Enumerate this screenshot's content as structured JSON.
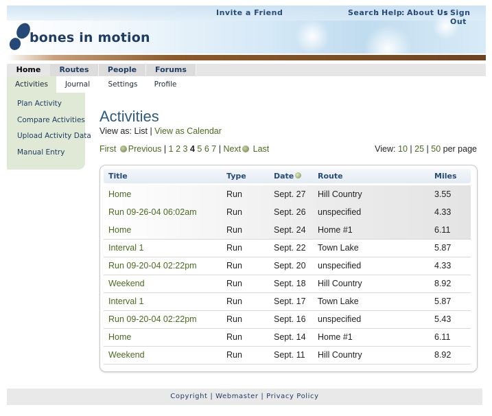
{
  "header": {
    "logo_text": "bones in motion",
    "invite_link": "Invite a Friend",
    "top_links": [
      "Search",
      "Help",
      "About Us",
      "Sign Out"
    ],
    "separator": ":"
  },
  "main_nav": {
    "tabs": [
      {
        "label": "Home",
        "active": true
      },
      {
        "label": "Routes",
        "active": false
      },
      {
        "label": "People",
        "active": false
      },
      {
        "label": "Forums",
        "active": false
      }
    ]
  },
  "sub_nav": {
    "tabs": [
      {
        "label": "Activities",
        "active": true
      },
      {
        "label": "Journal",
        "active": false
      },
      {
        "label": "Settings",
        "active": false
      },
      {
        "label": "Profile",
        "active": false
      }
    ]
  },
  "sidebar": {
    "items": [
      "Plan Activity",
      "Compare Activities",
      "Upload Activity Data",
      "Manual Entry"
    ]
  },
  "content": {
    "title": "Activities",
    "view_as_label": "View as:",
    "view_list": "List",
    "view_sep": "|",
    "view_calendar": "View as Calendar",
    "pager": {
      "first": "First",
      "previous": "Previous",
      "pages": [
        "1",
        "2",
        "3",
        "4",
        "5",
        "6",
        "7"
      ],
      "current_page": "4",
      "next": "Next",
      "last": "Last"
    },
    "per_page": {
      "label": "View:",
      "options": [
        "10",
        "25",
        "50"
      ],
      "suffix": "per page"
    },
    "table": {
      "headers": {
        "title": "Title",
        "type": "Type",
        "date": "Date",
        "route": "Route",
        "miles": "Miles"
      },
      "rows": [
        {
          "title": "Home",
          "type": "Run",
          "date": "Sept. 27",
          "route": "Hill Country",
          "miles": "3.55",
          "shaded": true
        },
        {
          "title": "Run 09-26-04 06:02am",
          "type": "Run",
          "date": "Sept. 26",
          "route": "unspecified",
          "miles": "4.33",
          "shaded": true
        },
        {
          "title": "Home",
          "type": "Run",
          "date": "Sept. 24",
          "route": "Home #1",
          "miles": "6.11",
          "shaded": true
        },
        {
          "title": "Interval 1",
          "type": "Run",
          "date": "Sept. 22",
          "route": "Town Lake",
          "miles": "5.87",
          "shaded": false
        },
        {
          "title": "Run 09-20-04 02:22pm",
          "type": "Run",
          "date": "Sept. 20",
          "route": "unspecified",
          "miles": "4.33",
          "shaded": false
        },
        {
          "title": "Weekend",
          "type": "Run",
          "date": "Sept. 18",
          "route": "Hill Country",
          "miles": "8.92",
          "shaded": false
        },
        {
          "title": "Interval 1",
          "type": "Run",
          "date": "Sept. 17",
          "route": "Town Lake",
          "miles": "5.87",
          "shaded": false
        },
        {
          "title": "Run 09-20-04 02:22pm",
          "type": "Run",
          "date": "Sept. 16",
          "route": "unspecified",
          "miles": "5.43",
          "shaded": false
        },
        {
          "title": "Home",
          "type": "Run",
          "date": "Sept. 14",
          "route": "Home #1",
          "miles": "6.11",
          "shaded": false
        },
        {
          "title": "Weekend",
          "type": "Run",
          "date": "Sept. 11",
          "route": "Hill Country",
          "miles": "8.92",
          "shaded": false
        }
      ]
    }
  },
  "footer": {
    "links": [
      "Copyright",
      "Webmaster",
      "Privacy Policy"
    ],
    "separator": "|"
  },
  "colors": {
    "brand_blue": "#1f3c64",
    "link_green": "#4a6a1e",
    "sidebar_bg": "#dfe9d6",
    "title_blue": "#2d5a7c"
  }
}
